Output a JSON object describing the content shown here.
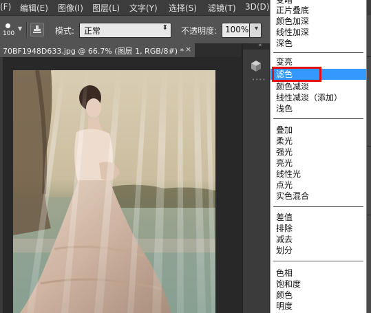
{
  "menubar": {
    "items": [
      "(F)",
      "编辑(E)",
      "图像(I)",
      "图层(L)",
      "文字(Y)",
      "选择(S)",
      "滤镜(T)",
      "3D(D)"
    ]
  },
  "options": {
    "brush_size": "100",
    "mode_label": "模式:",
    "mode_value": "正常",
    "opacity_label": "不透明度:",
    "opacity_value": "100%"
  },
  "document": {
    "tab_title": "70BF1948D633.jpg @ 66.7% (图层 1, RGB/8#) *",
    "close_glyph": "×"
  },
  "blend_menu": {
    "selected": "滤色",
    "items": [
      "变暗",
      "正片叠底",
      "颜色加深",
      "线性加深",
      "深色",
      "变亮",
      "滤色",
      "颜色减淡",
      "线性减淡（添加）",
      "浅色",
      "叠加",
      "柔光",
      "强光",
      "亮光",
      "线性光",
      "点光",
      "实色混合",
      "差值",
      "排除",
      "减去",
      "划分",
      "色相",
      "饱和度",
      "颜色",
      "明度"
    ]
  },
  "colors": {
    "highlight": "#3399ff",
    "annotation_box": "#e01010"
  }
}
